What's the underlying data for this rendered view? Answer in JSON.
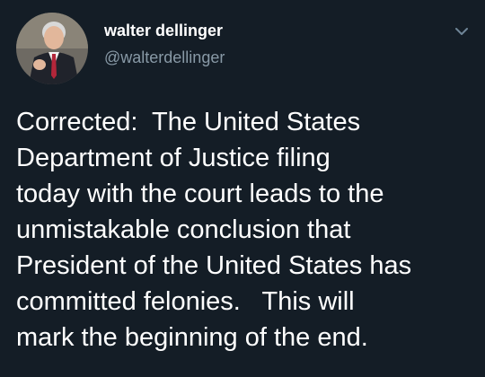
{
  "colors": {
    "background": "#141d26",
    "primary_text": "#ffffff",
    "secondary_text": "#8899a6"
  },
  "author": {
    "display_name": "walter dellinger",
    "handle": "@walterdellinger",
    "avatar_icon": "person-portrait"
  },
  "menu": {
    "icon": "chevron-down-icon"
  },
  "tweet": {
    "text": "Corrected:  The United States\nDepartment of Justice filing\ntoday with the court leads to the\nunmistakable conclusion that\nPresident of the United States has\ncommitted felonies.   This will\nmark the beginning of the end."
  }
}
